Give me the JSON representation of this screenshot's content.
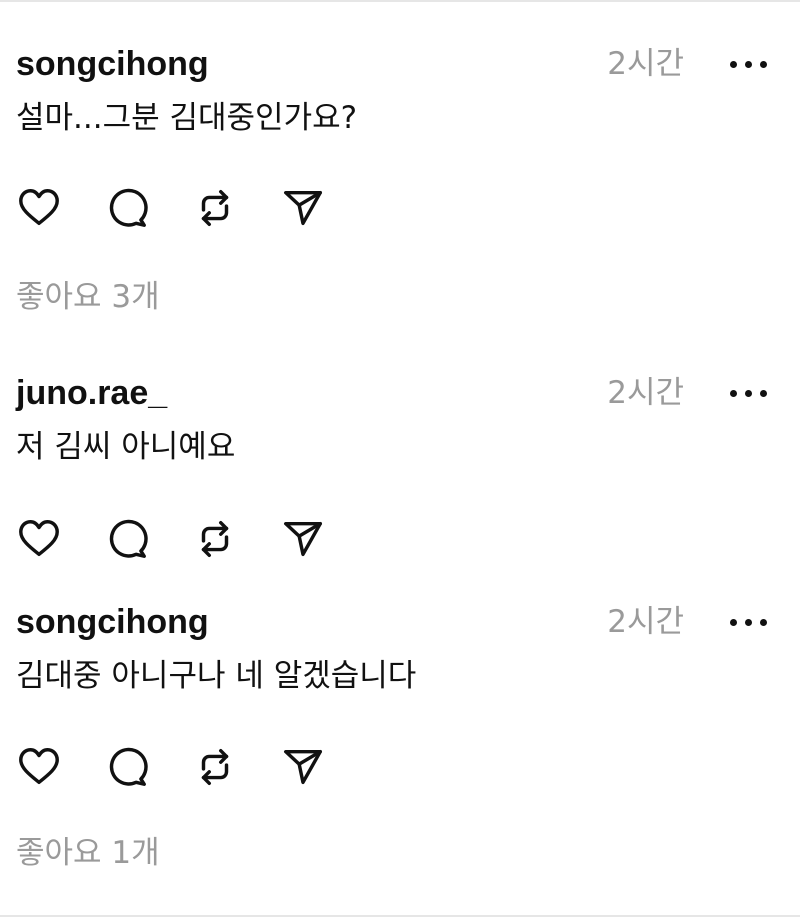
{
  "comments": [
    {
      "username": "songcihong",
      "time": "2시간",
      "text": "설마...그분 김대중인가요?",
      "likes": "좋아요 3개"
    },
    {
      "username": "juno.rae_",
      "time": "2시간",
      "text": "저 김씨 아니예요",
      "likes": ""
    },
    {
      "username": "songcihong",
      "time": "2시간",
      "text": "김대중 아니구나 네 알겠습니다",
      "likes": "좋아요 1개"
    }
  ],
  "icons": {
    "like": "heart-icon",
    "reply": "comment-bubble-icon",
    "repost": "repost-icon",
    "share": "send-icon",
    "more": "more-dots-icon"
  }
}
